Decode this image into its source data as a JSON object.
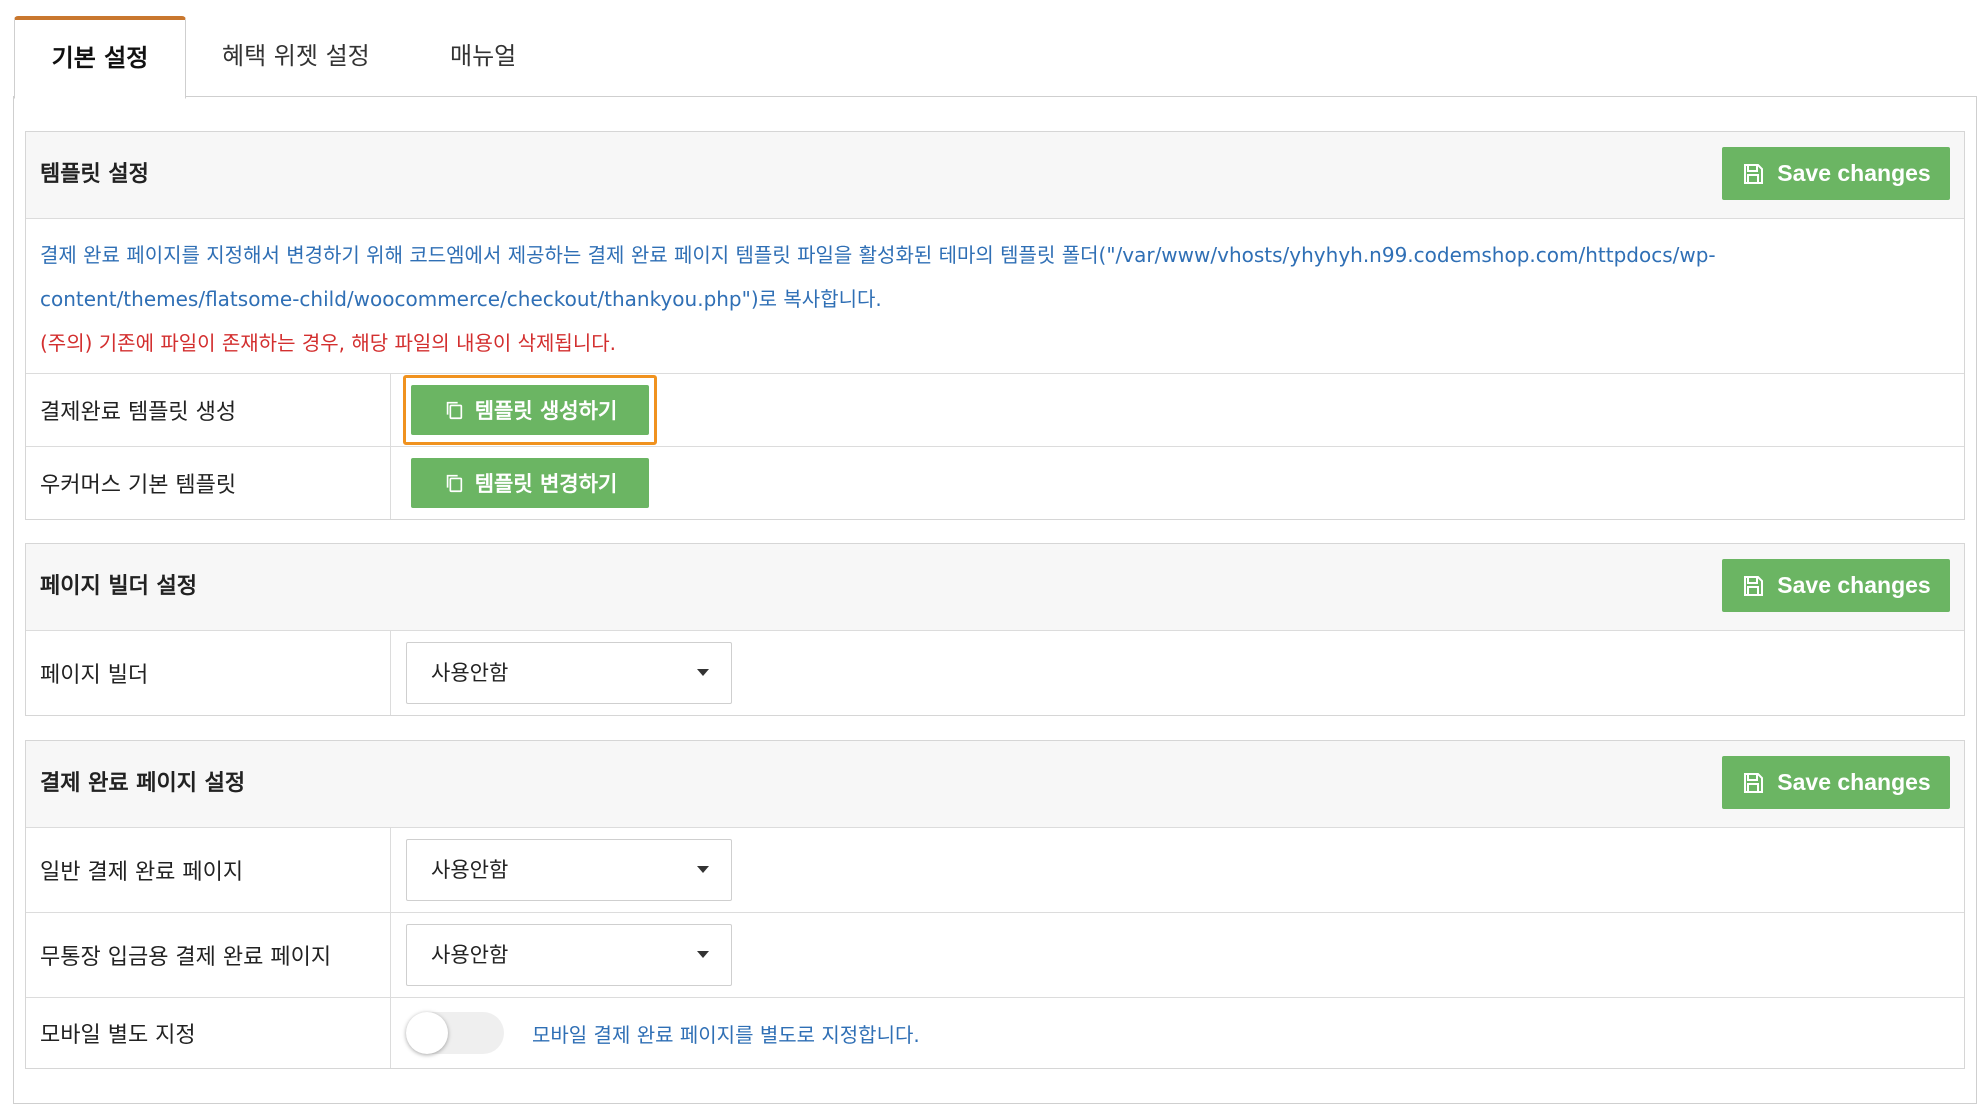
{
  "tabs": [
    {
      "label": "기본 설정",
      "active": true
    },
    {
      "label": "혜택 위젯 설정",
      "active": false
    },
    {
      "label": "매뉴얼",
      "active": false
    }
  ],
  "colors": {
    "accent": "#c9772e",
    "button_green": "#6bb563",
    "highlight": "#f0921f",
    "info_blue": "#2f6fb5",
    "warning_red": "#d32f2f"
  },
  "save_label": "Save changes",
  "template_section": {
    "title": "템플릿 설정",
    "desc_line1": "결제 완료 페이지를 지정해서 변경하기 위해 코드엠에서 제공하는 결제 완료 페이지 템플릿 파일을 활성화된 테마의 템플릿 폴더(\"/var/www/vhosts/yhyhyh.n99.codemshop.com/httpdocs/wp-",
    "desc_line2": "content/themes/flatsome-child/woocommerce/checkout/thankyou.php\")로 복사합니다.",
    "warning": "(주의) 기존에 파일이 존재하는 경우, 해당 파일의 내용이 삭제됩니다.",
    "rows": [
      {
        "label": "결제완료 템플릿 생성",
        "button": "템플릿 생성하기"
      },
      {
        "label": "우커머스 기본 템플릿",
        "button": "템플릿 변경하기"
      }
    ]
  },
  "builder_section": {
    "title": "페이지 빌더 설정",
    "rows": [
      {
        "label": "페이지 빌더",
        "value": "사용안함"
      }
    ]
  },
  "checkout_section": {
    "title": "결제 완료 페이지 설정",
    "rows": [
      {
        "label": "일반 결제 완료 페이지",
        "value": "사용안함"
      },
      {
        "label": "무통장 입금용 결제 완료 페이지",
        "value": "사용안함"
      }
    ],
    "mobile": {
      "label": "모바일 별도 지정",
      "toggle_on": false,
      "desc": "모바일 결제 완료 페이지를 별도로 지정합니다."
    }
  }
}
